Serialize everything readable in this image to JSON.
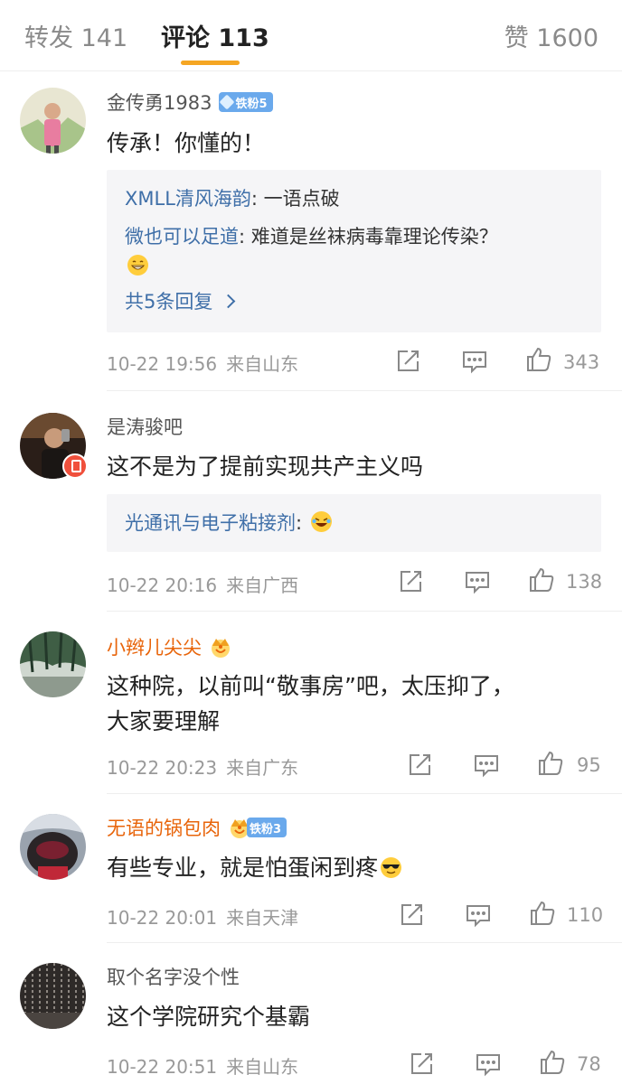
{
  "tabs": {
    "reposts": "转发 141",
    "comments": "评论 113",
    "likes": "赞 1600"
  },
  "colors": {
    "accent_underline": "#f5a623",
    "link_blue": "#3f6fa8",
    "vip_orange": "#e8640a",
    "fan_badge_blue": "#6aa9ec"
  },
  "comments": [
    {
      "user": "金传勇1983",
      "fan_badge": "铁粉5",
      "text": "传承！你懂的！",
      "replies": [
        {
          "user": "XMLL清风海韵",
          "text": ": 一语点破"
        },
        {
          "user": "微也可以足道",
          "text": ": 难道是丝袜病毒靠理论传染？"
        }
      ],
      "more_replies": "共5条回复",
      "time": "10-22 19:56",
      "location": "来自山东",
      "likes": "343"
    },
    {
      "user": "是涛骏吧",
      "text": "这不是为了提前实现共产主义吗",
      "replies": [
        {
          "user": "光通讯与电子粘接剂",
          "text": ":"
        }
      ],
      "time": "10-22 20:16",
      "location": "来自广西",
      "likes": "138"
    },
    {
      "user": "小辫儿尖尖",
      "text_line1": "这种院，以前叫“敬事房”吧，太压抑了，",
      "text_line2": "大家要理解",
      "time": "10-22 20:23",
      "location": "来自广东",
      "likes": "95"
    },
    {
      "user": "无语的锅包肉",
      "fan_badge": "铁粉3",
      "text": "有些专业，就是怕蛋闲到疼",
      "time": "10-22 20:01",
      "location": "来自天津",
      "likes": "110"
    },
    {
      "user": "取个名字没个性",
      "text": "这个学院研究个基霸",
      "time": "10-22 20:51",
      "location": "来自山东",
      "likes": "78"
    }
  ]
}
